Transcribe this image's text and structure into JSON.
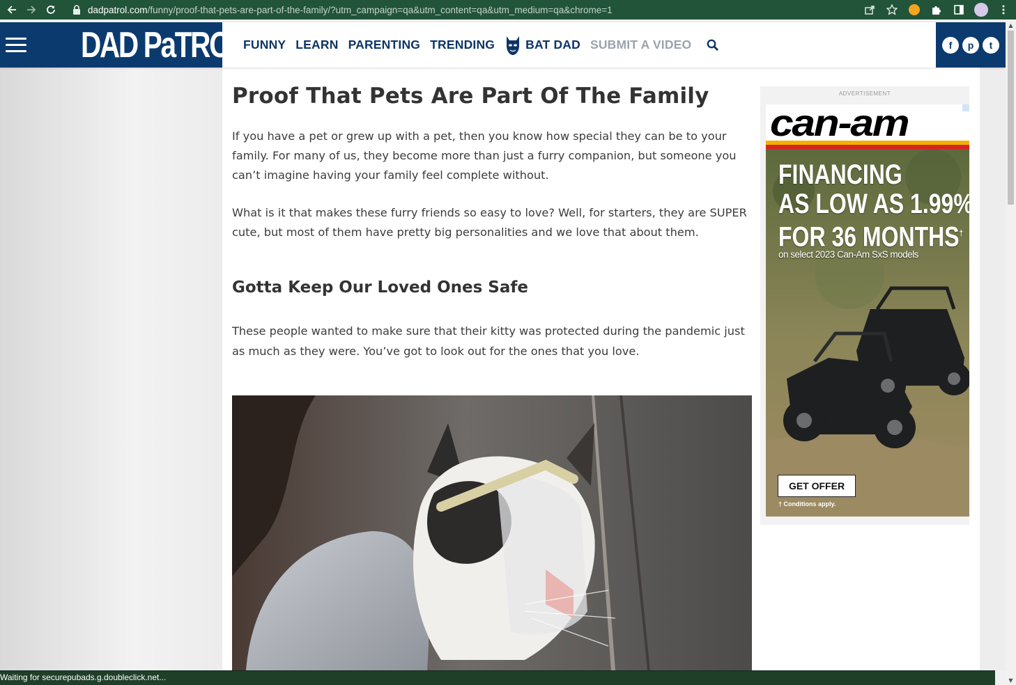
{
  "browser": {
    "url_host": "dadpatrol.com",
    "url_path": "/funny/proof-that-pets-are-part-of-the-family/?utm_campaign=qa&utm_content=qa&utm_medium=qa&chrome=1"
  },
  "site": {
    "logo": "DAD PaTROL",
    "nav": {
      "funny": "FUNNY",
      "learn": "LEARN",
      "parenting": "PARENTING",
      "trending": "TRENDING",
      "batdad": "BAT DAD",
      "submit": "SUBMIT A VIDEO"
    },
    "social": {
      "facebook": "f",
      "pinterest": "p",
      "twitter": "t"
    },
    "colors": {
      "brand_navy": "#0b3a6e",
      "nav_text": "#0d3566",
      "muted_nav": "#9aa4ae"
    }
  },
  "article": {
    "title": "Proof That Pets Are Part Of The Family",
    "paragraph1": "If you have a pet or grew up with a pet, then you know how special they can be to your family. For many of us, they become more than just a furry companion, but someone you can’t imagine having your family feel complete without.",
    "paragraph2": "What is it that makes these furry friends so easy to love? Well, for starters, they are SUPER cute, but most of them have pretty big personalities and we love that about them.",
    "heading2": "Gotta Keep Our Loved Ones Safe",
    "paragraph3": "These people wanted to make sure that their kitty was protected during the pandemic just as much as they were. You’ve got to look out for the ones that you love."
  },
  "ad": {
    "label": "ADVERTISEMENT",
    "brand": "can-am",
    "headline_line1": "FINANCING",
    "headline_line2": "AS LOW AS 1.99%",
    "headline_line3": "FOR 36 MONTHS",
    "headline_dagger": "†",
    "subline": "on select 2023 Can-Am SxS models",
    "cta": "GET OFFER",
    "conditions": "† Conditions apply."
  },
  "status": {
    "text": "Waiting for securepubads.g.doubleclick.net..."
  }
}
